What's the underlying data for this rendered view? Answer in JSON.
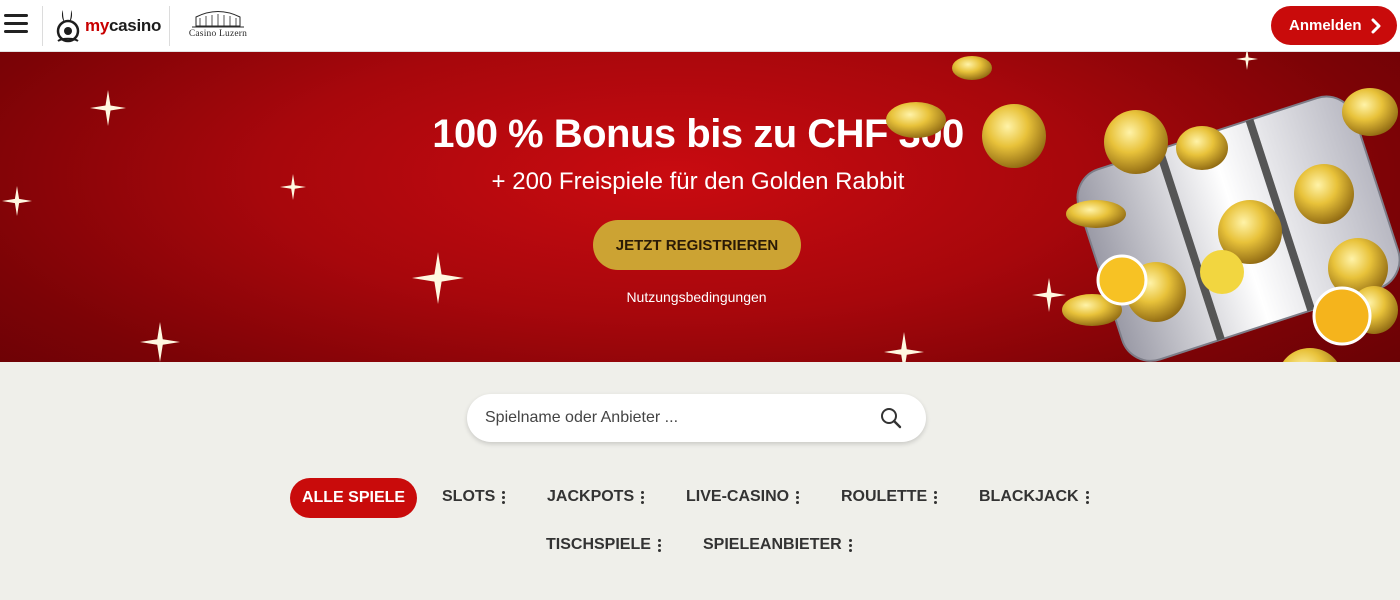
{
  "header": {
    "menu_icon": "hamburger-menu-icon",
    "logo_primary": {
      "my": "my",
      "casino": "casino"
    },
    "logo_secondary": "Casino Luzern",
    "login_label": "Anmelden",
    "login_icon": "chevron-right-icon"
  },
  "hero": {
    "title": "100 % Bonus bis zu CHF 300",
    "subtitle": "+ 200 Freispiele für den Golden Rabbit",
    "cta_label": "JETZT REGISTRIEREN",
    "terms_link": "Nutzungsbedingungen"
  },
  "search": {
    "placeholder": "Spielname oder Anbieter ...",
    "value": "",
    "icon": "search-icon"
  },
  "categories": [
    {
      "label": "ALLE SPIELE",
      "active": true,
      "has_menu": false
    },
    {
      "label": "SLOTS",
      "active": false,
      "has_menu": true
    },
    {
      "label": "JACKPOTS",
      "active": false,
      "has_menu": true
    },
    {
      "label": "LIVE-CASINO",
      "active": false,
      "has_menu": true
    },
    {
      "label": "ROULETTE",
      "active": false,
      "has_menu": true
    },
    {
      "label": "BLACKJACK",
      "active": false,
      "has_menu": true
    },
    {
      "label": "TISCHSPIELE",
      "active": false,
      "has_menu": true
    },
    {
      "label": "SPIELEANBIETER",
      "active": false,
      "has_menu": true
    }
  ],
  "colors": {
    "brand_red": "#c90b0b",
    "cta_gold": "#cca333",
    "page_background": "#efefea"
  }
}
